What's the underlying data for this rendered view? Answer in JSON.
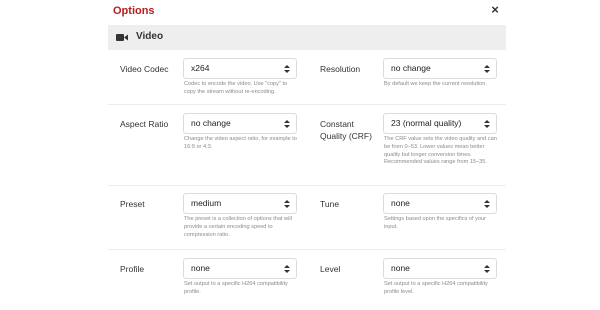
{
  "dialog": {
    "title": "Options",
    "close_symbol": "×",
    "section": {
      "title": "Video",
      "icon": "video-camera-icon"
    },
    "accent_color": "#b71c1c"
  },
  "options": {
    "video_codec": {
      "label": "Video Codec",
      "value": "x264",
      "help": "Codec to encode the video. Use \"copy\" to copy the stream without re-encoding."
    },
    "resolution": {
      "label": "Resolution",
      "value": "no change",
      "help": "By default we keep the current resolution."
    },
    "aspect_ratio": {
      "label": "Aspect Ratio",
      "value": "no change",
      "help": "Change the video aspect ratio, for example to 16:9 or 4:3."
    },
    "crf": {
      "label_line1": "Constant",
      "label_line2": "Quality (CRF)",
      "value": "23 (normal quality)",
      "help": "The CRF value sets the video quality and can be from 0–53. Lower values mean better quality but longer conversion times. Recommended values range from 15–35."
    },
    "preset": {
      "label": "Preset",
      "value": "medium",
      "help": "The preset is a collection of options that will provide a certain encoding speed to compression ratio."
    },
    "tune": {
      "label": "Tune",
      "value": "none",
      "help": "Settings based upon the specifics of your input."
    },
    "profile": {
      "label": "Profile",
      "value": "none",
      "help": "Set output to a specific H264 compatibility profile."
    },
    "level": {
      "label": "Level",
      "value": "none",
      "help": "Set output to a specific H264 compatibility profile level."
    }
  }
}
